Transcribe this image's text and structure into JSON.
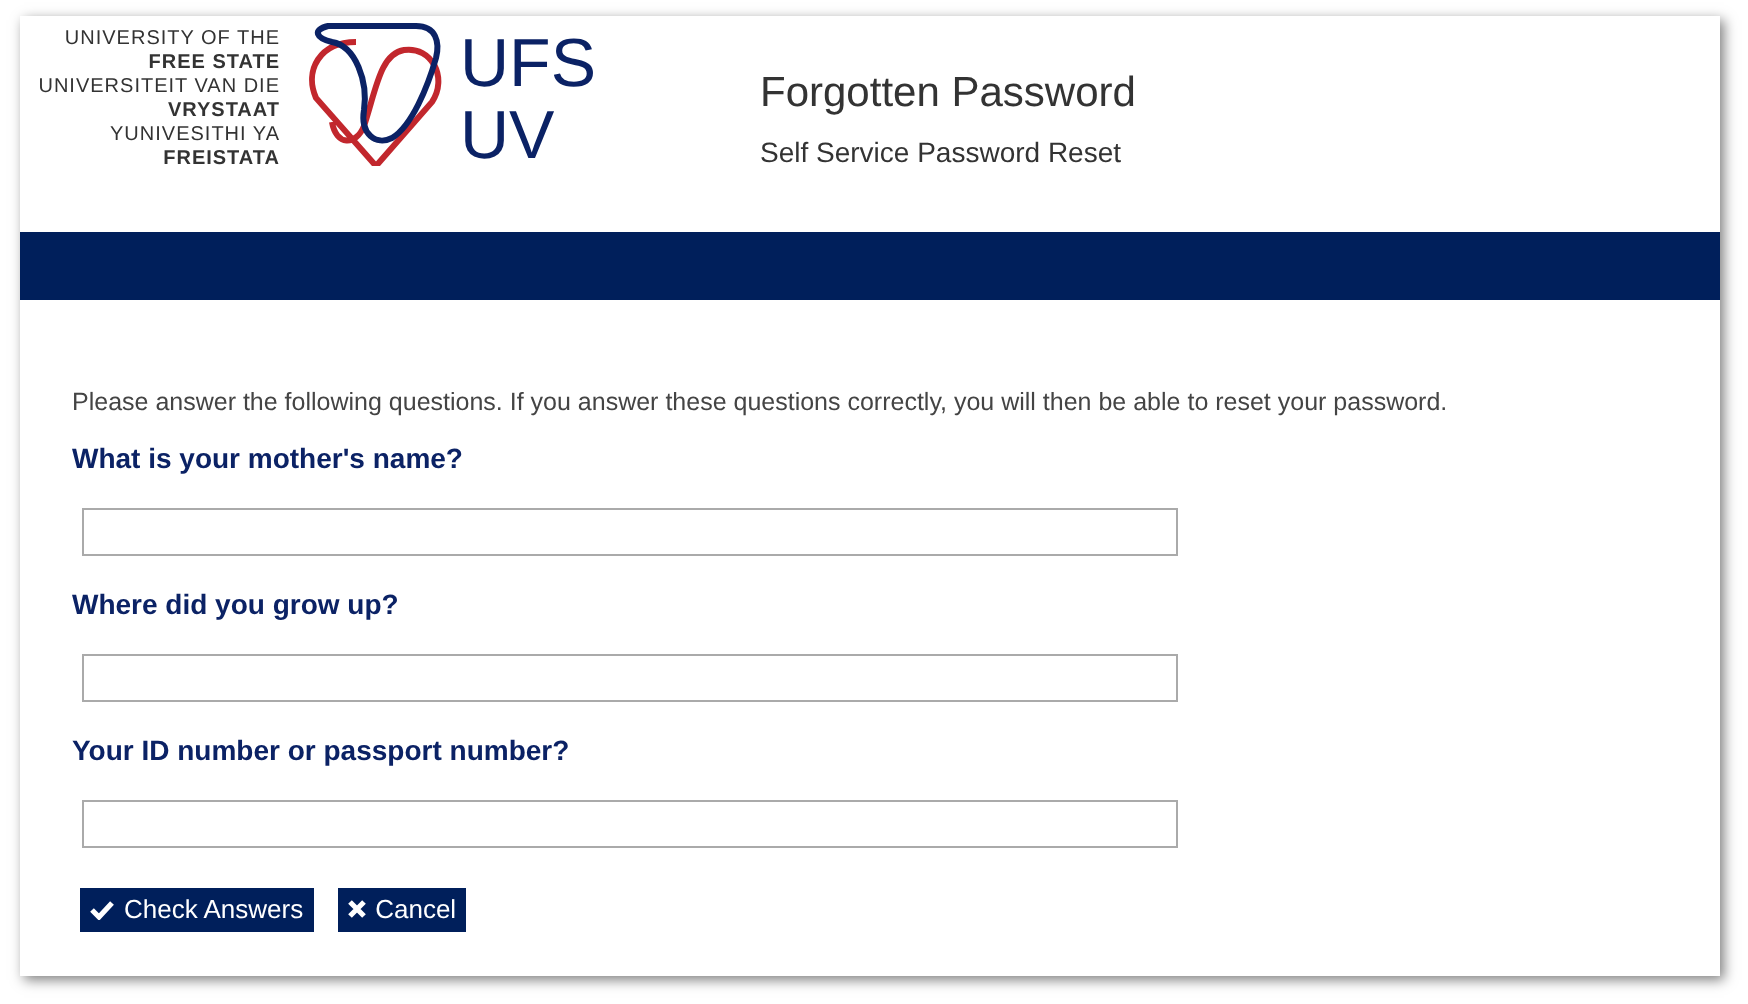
{
  "logo": {
    "lines": [
      {
        "text": "UNIVERSITY OF THE",
        "bold": false
      },
      {
        "text": "FREE STATE",
        "bold": true
      },
      {
        "text": "UNIVERSITEIT VAN DIE",
        "bold": false
      },
      {
        "text": "VRYSTAAT",
        "bold": true
      },
      {
        "text": "YUNIVESITHI YA",
        "bold": false
      },
      {
        "text": "FREISTATA",
        "bold": true
      }
    ],
    "mark_top": "UFS",
    "mark_bottom": "UV"
  },
  "header": {
    "title": "Forgotten Password",
    "subtitle": "Self Service Password Reset"
  },
  "intro": "Please answer the following questions. If you answer these questions correctly, you will then be able to reset your password.",
  "questions": [
    {
      "label": "What is your mother's name?"
    },
    {
      "label": "Where did you grow up?"
    },
    {
      "label": "Your ID number or passport number?"
    }
  ],
  "buttons": [
    {
      "kind": "check",
      "label": "Check Answers"
    },
    {
      "kind": "cancel",
      "label": "Cancel"
    }
  ]
}
